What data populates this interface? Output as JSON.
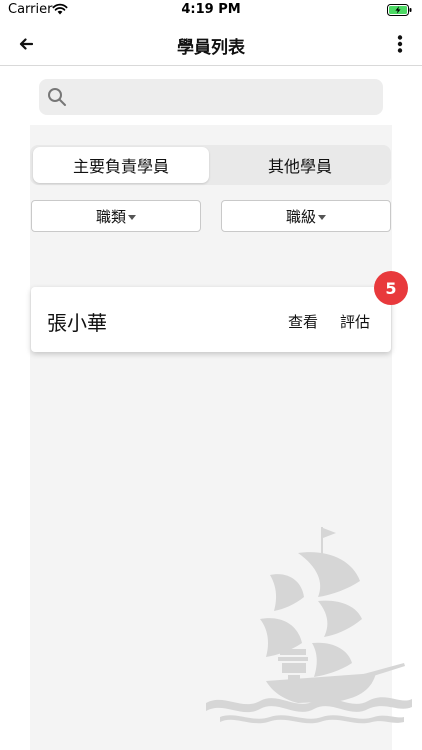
{
  "status_bar": {
    "carrier": "Carrier",
    "time": "4:19 PM",
    "icons": [
      "wifi-icon",
      "battery-charging-icon"
    ]
  },
  "nav": {
    "title": "學員列表",
    "back_icon": "arrow-left-icon",
    "more_icon": "more-vertical-icon"
  },
  "search": {
    "placeholder": "",
    "icon": "search-icon"
  },
  "tabs": [
    {
      "label": "主要負責學員",
      "selected": true
    },
    {
      "label": "其他學員",
      "selected": false
    }
  ],
  "filters": [
    {
      "label": "職類",
      "icon": "caret-down-icon"
    },
    {
      "label": "職級",
      "icon": "caret-down-icon"
    }
  ],
  "students": [
    {
      "name": "張小華",
      "view_label": "查看",
      "evaluate_label": "評估",
      "badge_count": "5"
    }
  ],
  "colors": {
    "badge": "#e8393c",
    "panel_background": "#f4f4f4",
    "segment_background": "#e9e9e9"
  },
  "decorations": [
    "sailing-ship-watermark"
  ]
}
